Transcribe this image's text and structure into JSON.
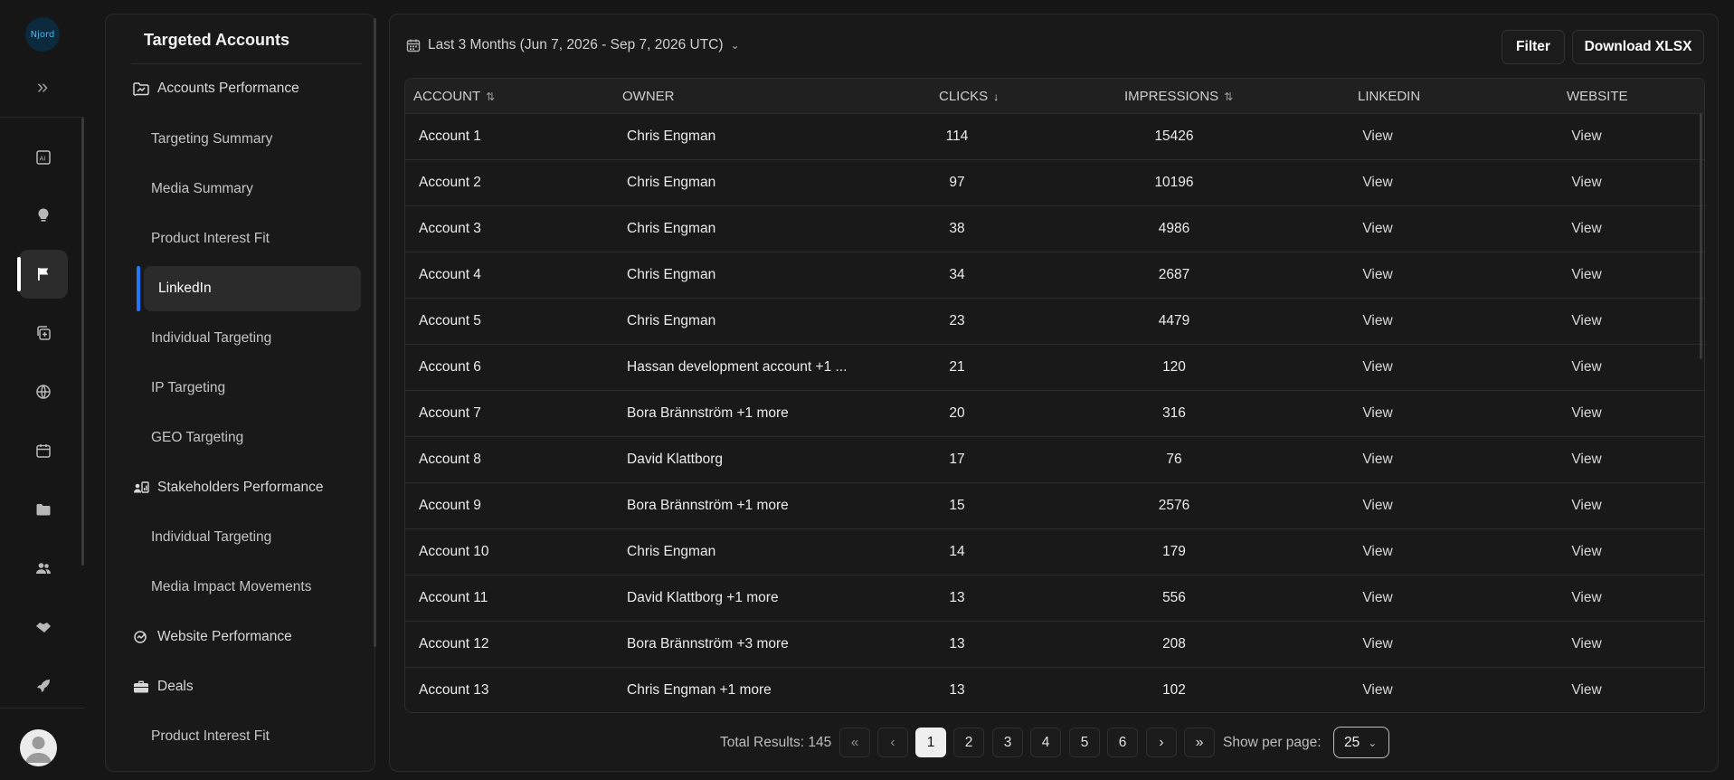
{
  "rail": {
    "logo": "Njord",
    "items": [
      {
        "name": "ai-report-icon"
      },
      {
        "name": "lightbulb-icon"
      },
      {
        "name": "flag-icon",
        "active": true
      },
      {
        "name": "add-copy-icon"
      },
      {
        "name": "globe-icon"
      },
      {
        "name": "calendar-icon"
      },
      {
        "name": "folder-icon"
      },
      {
        "name": "people-icon"
      },
      {
        "name": "handshake-icon"
      },
      {
        "name": "rocket-icon"
      }
    ]
  },
  "nav": {
    "title": "Targeted Accounts",
    "items": [
      {
        "type": "section",
        "label": "Accounts Performance",
        "icon": "folder-chart-icon"
      },
      {
        "type": "sub",
        "label": "Targeting Summary"
      },
      {
        "type": "sub",
        "label": "Media Summary"
      },
      {
        "type": "sub",
        "label": "Product Interest Fit"
      },
      {
        "type": "sub",
        "label": "LinkedIn",
        "active": true
      },
      {
        "type": "sub",
        "label": "Individual Targeting"
      },
      {
        "type": "sub",
        "label": "IP Targeting"
      },
      {
        "type": "sub",
        "label": "GEO Targeting"
      },
      {
        "type": "section",
        "label": "Stakeholders Performance",
        "icon": "stakeholders-icon"
      },
      {
        "type": "sub",
        "label": "Individual Targeting"
      },
      {
        "type": "sub",
        "label": "Media Impact Movements"
      },
      {
        "type": "section",
        "label": "Website Performance",
        "icon": "website-performance-icon"
      },
      {
        "type": "section",
        "label": "Deals",
        "icon": "briefcase-icon"
      },
      {
        "type": "sub",
        "label": "Product Interest Fit"
      }
    ]
  },
  "toolbar": {
    "date_range": "Last 3 Months (Jun 7, 2026 - Sep 7, 2026 UTC)",
    "filter_label": "Filter",
    "download_label": "Download XLSX"
  },
  "table": {
    "headers": {
      "account": "ACCOUNT",
      "owner": "OWNER",
      "clicks": "CLICKS",
      "impressions": "IMPRESSIONS",
      "linkedin": "LINKEDIN",
      "website": "WEBSITE"
    },
    "rows": [
      {
        "account": "Account 1",
        "owner": "Chris Engman",
        "clicks": "114",
        "impressions": "15426",
        "linkedin": "View",
        "website": "View"
      },
      {
        "account": "Account 2",
        "owner": "Chris Engman",
        "clicks": "97",
        "impressions": "10196",
        "linkedin": "View",
        "website": "View"
      },
      {
        "account": "Account 3",
        "owner": "Chris Engman",
        "clicks": "38",
        "impressions": "4986",
        "linkedin": "View",
        "website": "View"
      },
      {
        "account": "Account 4",
        "owner": "Chris Engman",
        "clicks": "34",
        "impressions": "2687",
        "linkedin": "View",
        "website": "View"
      },
      {
        "account": "Account 5",
        "owner": "Chris Engman",
        "clicks": "23",
        "impressions": "4479",
        "linkedin": "View",
        "website": "View"
      },
      {
        "account": "Account 6",
        "owner": "Hassan development account +1 ...",
        "clicks": "21",
        "impressions": "120",
        "linkedin": "View",
        "website": "View"
      },
      {
        "account": "Account 7",
        "owner": "Bora Brännström +1 more",
        "clicks": "20",
        "impressions": "316",
        "linkedin": "View",
        "website": "View"
      },
      {
        "account": "Account 8",
        "owner": "David Klattborg",
        "clicks": "17",
        "impressions": "76",
        "linkedin": "View",
        "website": "View"
      },
      {
        "account": "Account 9",
        "owner": "Bora Brännström +1 more",
        "clicks": "15",
        "impressions": "2576",
        "linkedin": "View",
        "website": "View"
      },
      {
        "account": "Account 10",
        "owner": "Chris Engman",
        "clicks": "14",
        "impressions": "179",
        "linkedin": "View",
        "website": "View"
      },
      {
        "account": "Account 11",
        "owner": "David Klattborg +1 more",
        "clicks": "13",
        "impressions": "556",
        "linkedin": "View",
        "website": "View"
      },
      {
        "account": "Account 12",
        "owner": "Bora Brännström +3 more",
        "clicks": "13",
        "impressions": "208",
        "linkedin": "View",
        "website": "View"
      },
      {
        "account": "Account 13",
        "owner": "Chris Engman +1 more",
        "clicks": "13",
        "impressions": "102",
        "linkedin": "View",
        "website": "View"
      }
    ]
  },
  "pagination": {
    "total_label": "Total Results: 145",
    "pages": [
      "1",
      "2",
      "3",
      "4",
      "5",
      "6"
    ],
    "current_page": "1",
    "per_page_label": "Show per page:",
    "per_page_value": "25"
  },
  "colors": {
    "accent": "#1e78ff",
    "background": "#161616",
    "panel": "#191919"
  }
}
